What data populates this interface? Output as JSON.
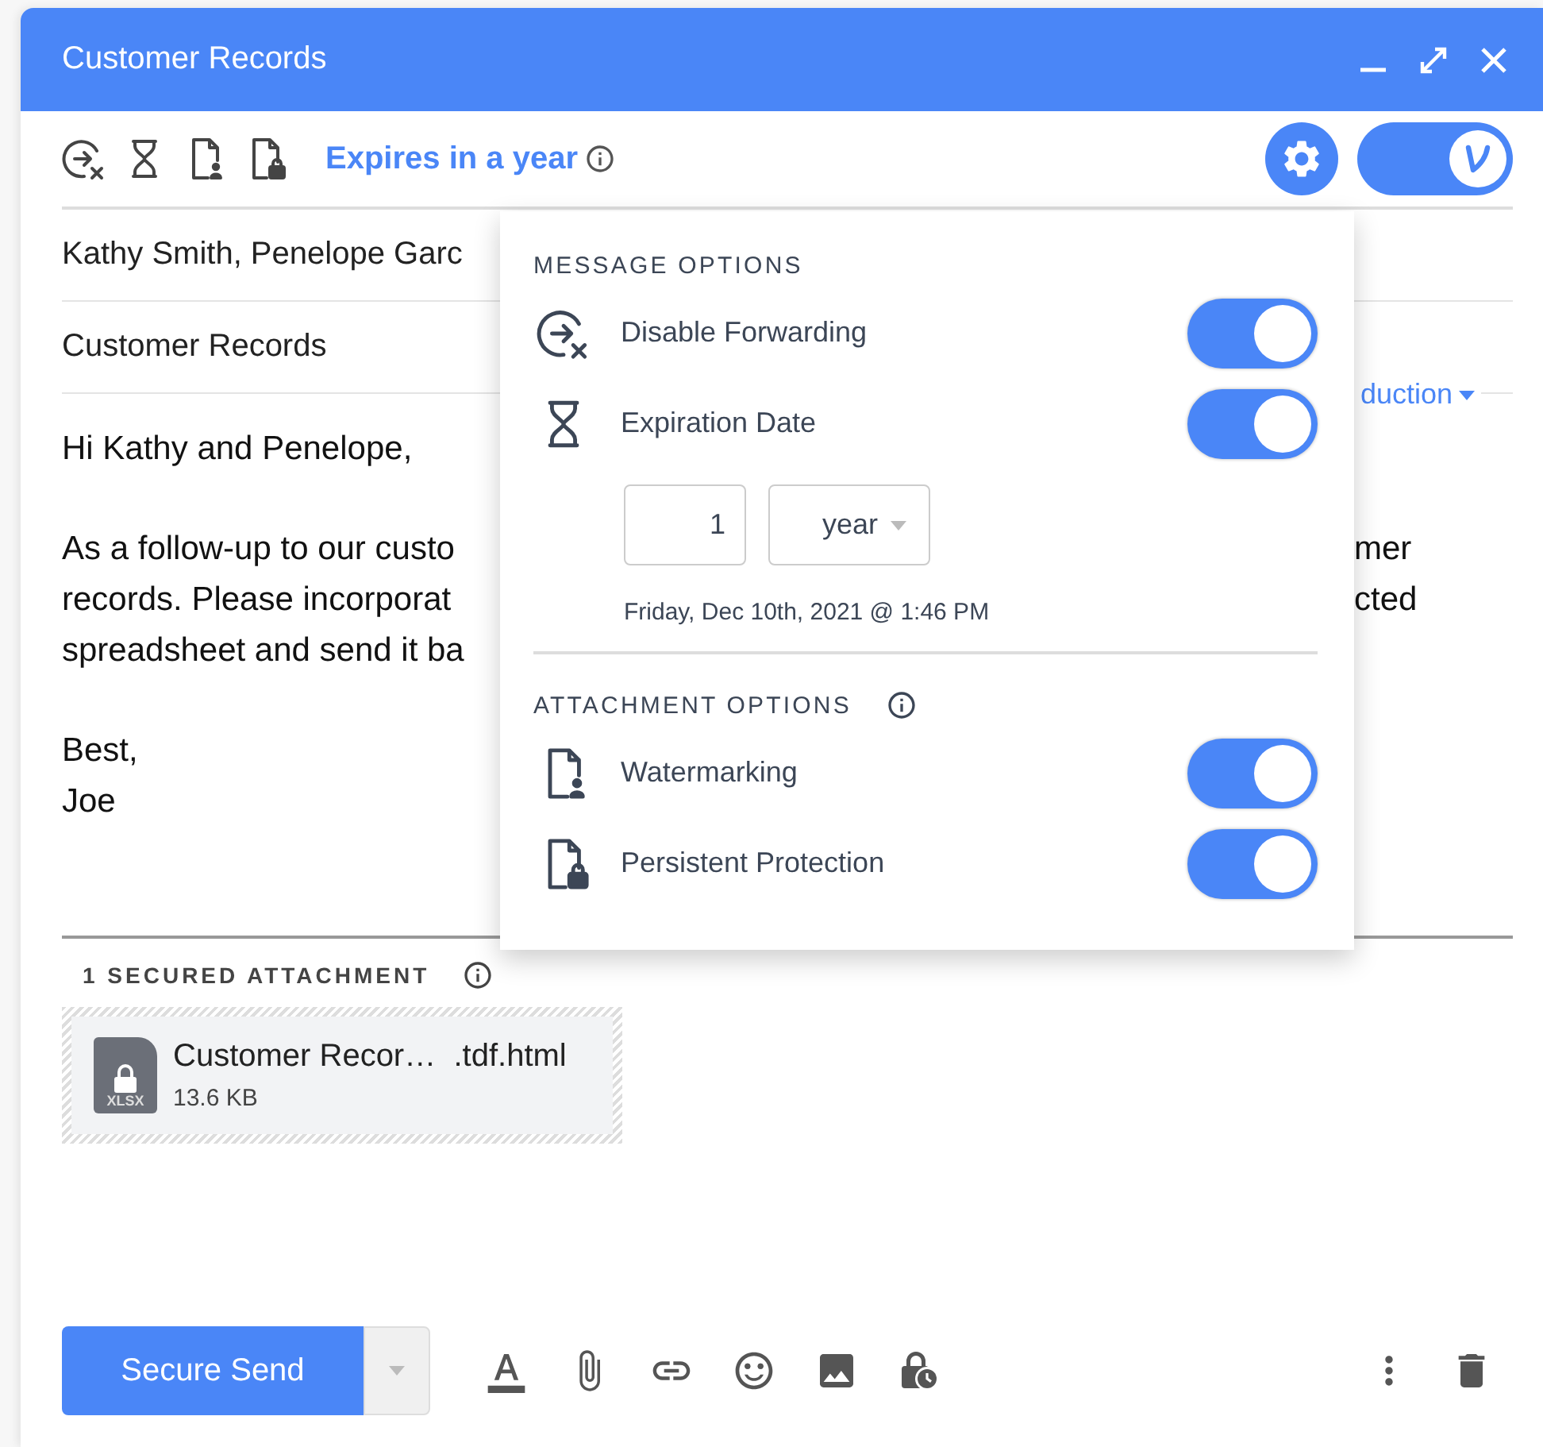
{
  "window": {
    "title": "Customer Records"
  },
  "toolbar": {
    "expiry_label": "Expires in a year",
    "secure_toggle": {
      "on": true
    }
  },
  "recipients": {
    "value": "Kathy Smith, Penelope Garc"
  },
  "subject": {
    "value": "Customer Records",
    "dropdown": "duction"
  },
  "body": {
    "lines": [
      {
        "left": "Hi Kathy and Penelope,"
      },
      {
        "left": "As a follow-up to our custo",
        "right": "mer"
      },
      {
        "left": "records. Please incorporat",
        "right": "cted"
      },
      {
        "left": "spreadsheet and send it ba"
      },
      {
        "left": "Best,"
      },
      {
        "left": "Joe"
      }
    ]
  },
  "attachments": {
    "header": "1 SECURED ATTACHMENT",
    "items": [
      {
        "name": "Customer Recor…",
        "extension": ".tdf.html",
        "size": "13.6 KB",
        "type": "XLSX"
      }
    ]
  },
  "send_button": "Secure Send",
  "popup": {
    "sections": [
      {
        "title": "MESSAGE OPTIONS",
        "options": [
          {
            "kind": "forwarding",
            "label": "Disable Forwarding",
            "on": true
          },
          {
            "kind": "expiration",
            "label": "Expiration Date",
            "on": true
          }
        ]
      },
      {
        "title": "ATTACHMENT OPTIONS",
        "info": true,
        "options": [
          {
            "kind": "watermark",
            "label": "Watermarking",
            "on": true
          },
          {
            "kind": "protection",
            "label": "Persistent Protection",
            "on": true
          }
        ]
      }
    ],
    "expiry": {
      "amount": "1",
      "unit": "year",
      "date": "Friday, Dec 10th, 2021 @ 1:46 PM"
    }
  }
}
